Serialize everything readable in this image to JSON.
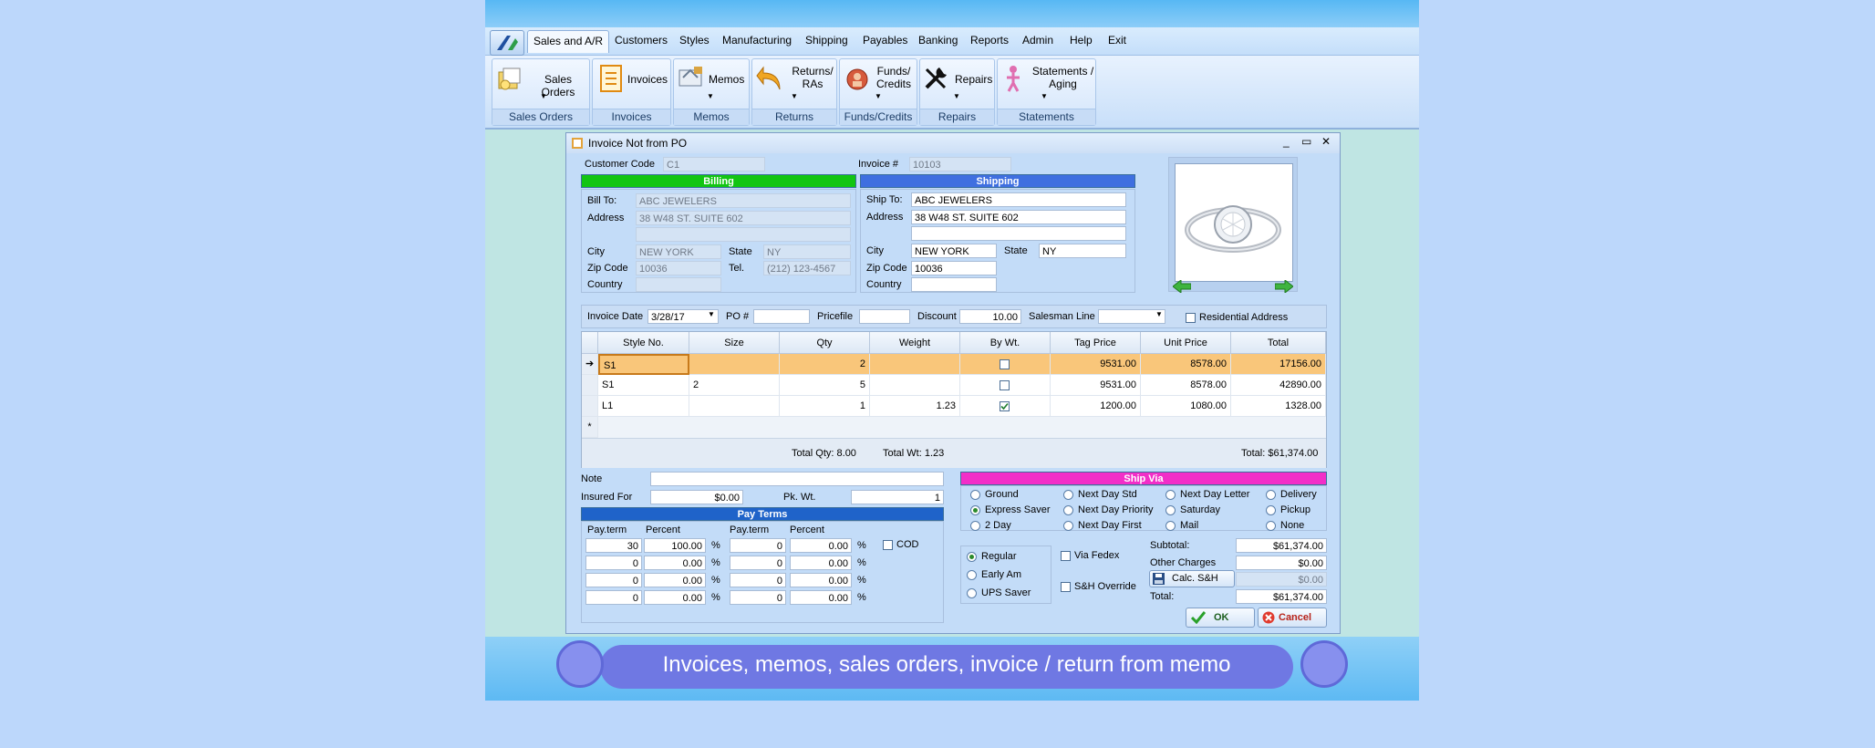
{
  "colors": {
    "billing_header": "#12c512",
    "shipping_header": "#3f6fe0",
    "pay_terms_header": "#1f63c9",
    "ship_via_header": "#f22ec8",
    "selected_row": "#f9c67a",
    "banner_pill": "#6f78e3"
  },
  "menu": {
    "items": [
      "Sales and A/R",
      "Customers",
      "Styles",
      "Manufacturing",
      "Shipping",
      "Payables",
      "Banking",
      "Reports",
      "Admin",
      "Help",
      "Exit"
    ]
  },
  "ribbon": {
    "groups": [
      {
        "button": "Sales Orders",
        "label": "Sales Orders",
        "icon": "sales-orders-icon"
      },
      {
        "button": "Invoices",
        "label": "Invoices",
        "icon": "invoices-icon"
      },
      {
        "button": "Memos",
        "label": "Memos",
        "icon": "memos-icon"
      },
      {
        "button": "Returns/ RAs",
        "label": "Returns",
        "icon": "returns-icon"
      },
      {
        "button": "Funds/ Credits",
        "label": "Funds/Credits",
        "icon": "funds-icon"
      },
      {
        "button": "Repairs",
        "label": "Repairs",
        "icon": "repairs-icon"
      },
      {
        "button": "Statements / Aging",
        "label": "Statements",
        "icon": "statements-icon"
      }
    ]
  },
  "window": {
    "title": "Invoice Not from PO"
  },
  "header": {
    "customer_code_label": "Customer Code",
    "customer_code": "C1",
    "invoice_no_label": "Invoice #",
    "invoice_no": "10103"
  },
  "billing": {
    "title": "Billing",
    "bill_to_label": "Bill To:",
    "bill_to": "ABC JEWELERS",
    "address_label": "Address",
    "address": "38 W48 ST. SUITE 602",
    "city_label": "City",
    "city": "NEW YORK",
    "state_label": "State",
    "state": "NY",
    "zip_label": "Zip Code",
    "zip": "10036",
    "tel_label": "Tel.",
    "tel": "(212) 123-4567",
    "country_label": "Country",
    "country": ""
  },
  "shipping": {
    "title": "Shipping",
    "ship_to_label": "Ship To:",
    "ship_to": "ABC JEWELERS",
    "address_label": "Address",
    "address": "38 W48 ST. SUITE 602",
    "city_label": "City",
    "city": "NEW YORK",
    "state_label": "State",
    "state": "NY",
    "zip_label": "Zip Code",
    "zip": "10036",
    "country_label": "Country",
    "country": ""
  },
  "options": {
    "invoice_date_label": "Invoice Date",
    "invoice_date": "3/28/17",
    "po_label": "PO #",
    "po": "",
    "pricefile_label": "Pricefile",
    "pricefile": "",
    "discount_label": "Discount",
    "discount": "10.00",
    "salesman_label": "Salesman Line",
    "salesman": "",
    "residential_label": "Residential Address"
  },
  "grid": {
    "columns": [
      "Style No.",
      "Size",
      "Qty",
      "Weight",
      "By Wt.",
      "Tag Price",
      "Unit Price",
      "Total"
    ],
    "rows": [
      {
        "style": "S1",
        "size": "",
        "qty": "2",
        "weight": "",
        "by_wt": false,
        "tag": "9531.00",
        "unit": "8578.00",
        "total": "17156.00"
      },
      {
        "style": "S1",
        "size": "2",
        "qty": "5",
        "weight": "",
        "by_wt": false,
        "tag": "9531.00",
        "unit": "8578.00",
        "total": "42890.00"
      },
      {
        "style": "L1",
        "size": "",
        "qty": "1",
        "weight": "1.23",
        "by_wt": true,
        "tag": "1200.00",
        "unit": "1080.00",
        "total": "1328.00"
      }
    ],
    "new_row_marker": "*",
    "footer": {
      "total_qty": "Total Qty: 8.00",
      "total_wt": "Total Wt: 1.23",
      "total": "Total: $61,374.00"
    }
  },
  "note": {
    "note_label": "Note",
    "note": "",
    "insured_label": "Insured For",
    "insured": "$0.00",
    "pkwt_label": "Pk. Wt.",
    "pkwt": "1"
  },
  "pay_terms": {
    "title": "Pay Terms",
    "col1": "Pay.term",
    "col2": "Percent",
    "col3": "Pay.term",
    "col4": "Percent",
    "pct": "%",
    "cod_label": "COD",
    "rows": [
      [
        "30",
        "100.00",
        "0",
        "0.00"
      ],
      [
        "0",
        "0.00",
        "0",
        "0.00"
      ],
      [
        "0",
        "0.00",
        "0",
        "0.00"
      ],
      [
        "0",
        "0.00",
        "0",
        "0.00"
      ]
    ]
  },
  "ship_via": {
    "title": "Ship Via",
    "options": [
      "Ground",
      "Next Day Std",
      "Next Day Letter",
      "Delivery",
      "Express Saver",
      "Next Day Priority",
      "Saturday",
      "Pickup",
      "2 Day",
      "Next Day First",
      "Mail",
      "None"
    ],
    "selected": "Express Saver"
  },
  "service": {
    "options": [
      "Regular",
      "Early Am",
      "UPS Saver"
    ],
    "selected": "Regular",
    "via_fedex_label": "Via Fedex",
    "sh_override_label": "S&H Override"
  },
  "totals": {
    "subtotal_label": "Subtotal:",
    "subtotal": "$61,374.00",
    "other_label": "Other Charges",
    "other": "$0.00",
    "calc_label": "Calc. S&H",
    "calc_value": "$0.00",
    "total_label": "Total:",
    "total": "$61,374.00"
  },
  "buttons": {
    "ok": "OK",
    "cancel": "Cancel"
  },
  "banner": {
    "text": "Invoices, memos, sales orders, invoice / return from memo"
  }
}
